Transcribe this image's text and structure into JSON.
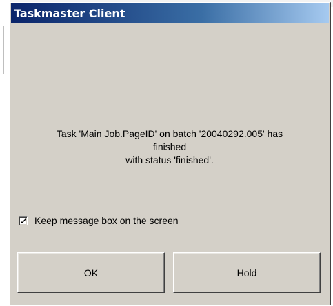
{
  "window": {
    "title": "Taskmaster Client"
  },
  "message": {
    "line1": "Task 'Main Job.PageID' on batch '20040292.005' has",
    "line2": "finished",
    "line3": "with status 'finished'."
  },
  "options": {
    "keep_on_screen_label": "Keep message box on the screen",
    "keep_on_screen_checked": true
  },
  "buttons": {
    "ok_label": "OK",
    "hold_label": "Hold"
  },
  "colors": {
    "titlebar_start": "#0a246a",
    "titlebar_end": "#a6caf0",
    "dialog_face": "#d4d0c8"
  },
  "icons": {
    "checkbox_mark": "check-icon"
  }
}
